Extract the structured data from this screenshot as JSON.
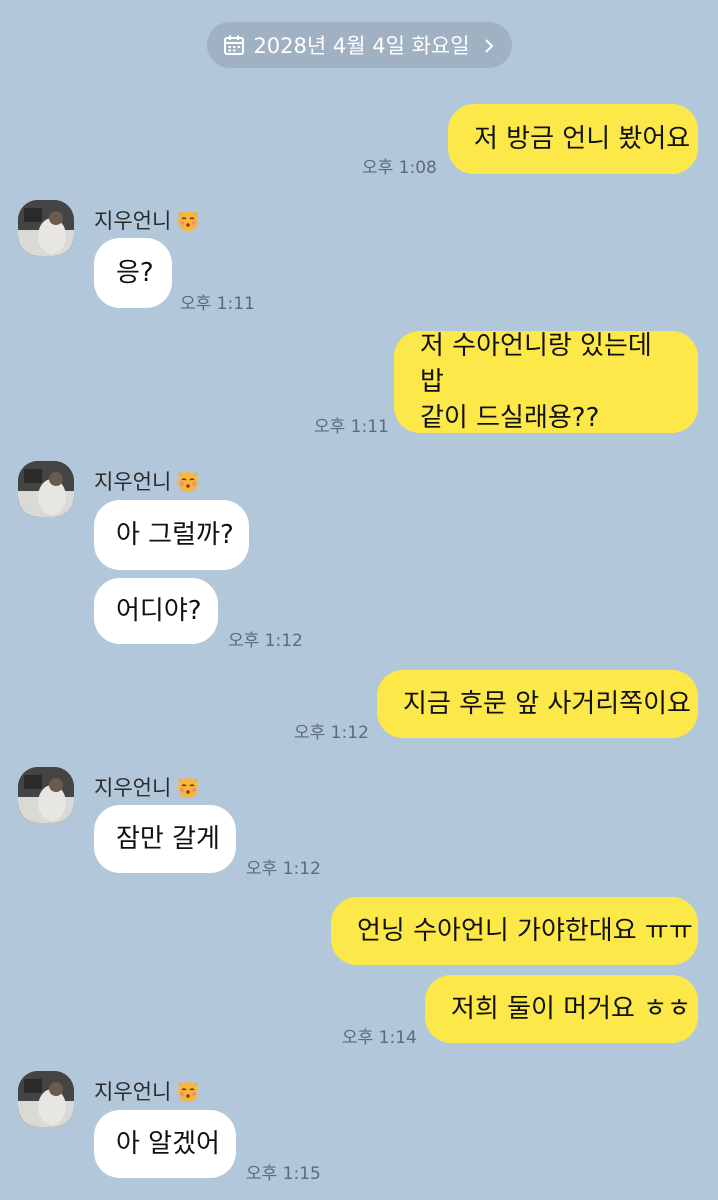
{
  "date_separator": {
    "label": "2028년 4월 4일 화요일",
    "icon": "calendar-icon",
    "chevron": "chevron-right-icon"
  },
  "contact": {
    "name": "지우언니",
    "emoji": "kissing-cat-emoji"
  },
  "colors": {
    "background": "#b2c7da",
    "my_bubble": "#fde84a",
    "their_bubble": "#ffffff"
  },
  "messages": [
    {
      "sender": "me",
      "text": "저 방금 언니 봤어요",
      "time": "오후 1:08"
    },
    {
      "sender": "them",
      "text": "응?",
      "time": "오후 1:11"
    },
    {
      "sender": "me",
      "lines": [
        "저 수아언니랑 있는데 밥",
        "같이 드실래용??"
      ],
      "time": "오후 1:11"
    },
    {
      "sender": "them",
      "text": "아 그럴까?"
    },
    {
      "sender": "them",
      "text": "어디야?",
      "time": "오후 1:12"
    },
    {
      "sender": "me",
      "text": "지금 후문 앞 사거리쪽이요",
      "time": "오후 1:12"
    },
    {
      "sender": "them",
      "text": "잠만 갈게",
      "time": "오후 1:12"
    },
    {
      "sender": "me",
      "text": "언닝 수아언니 가야한대요 ㅠㅠ"
    },
    {
      "sender": "me",
      "text": "저희 둘이 머거요 ㅎㅎ",
      "time": "오후 1:14"
    },
    {
      "sender": "them",
      "text": "아 알겠어",
      "time": "오후 1:15"
    }
  ]
}
